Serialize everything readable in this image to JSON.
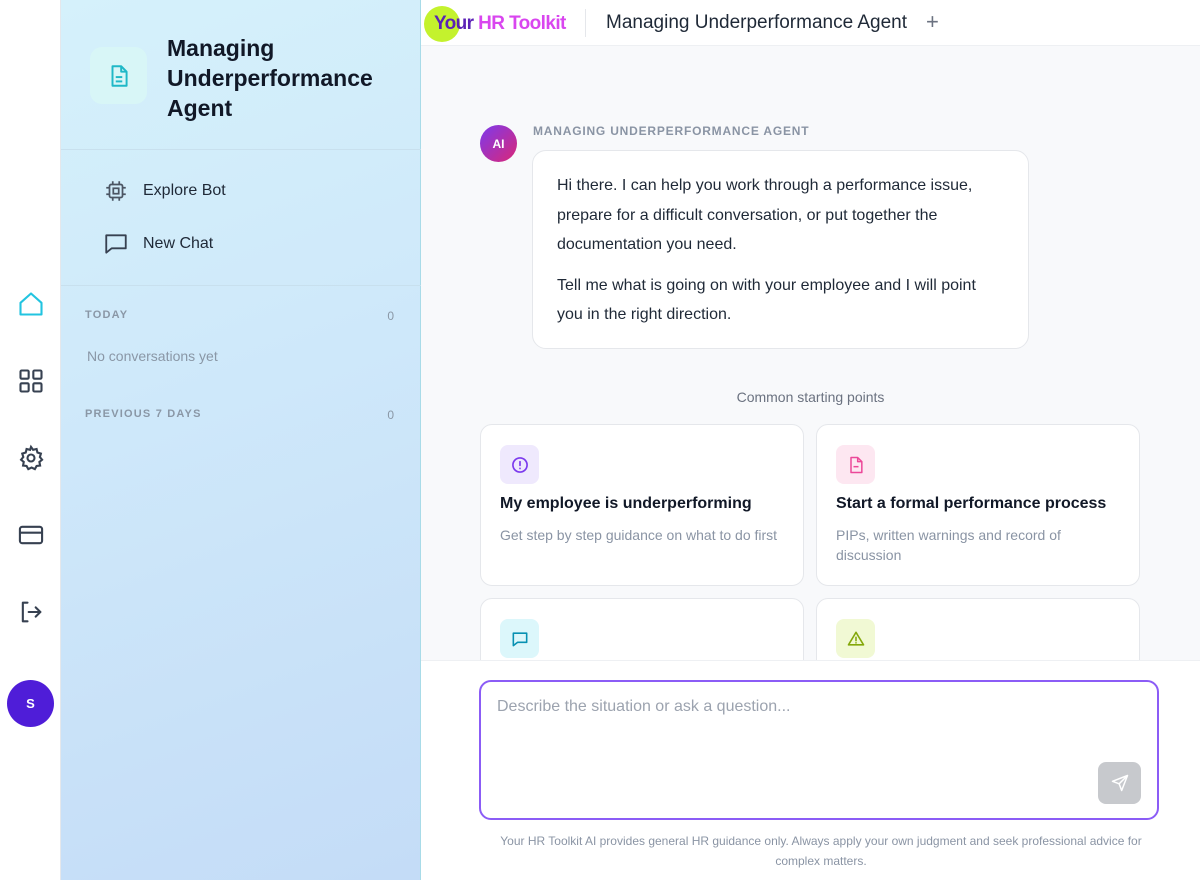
{
  "app": {
    "logo_part1": "Your",
    "logo_part2": "HR Toolkit",
    "tab_title": "Managing Underperformance Agent",
    "new_tab": "+"
  },
  "rail": {
    "items": [
      {
        "icon": "home-icon",
        "active": true
      },
      {
        "icon": "grid-icon"
      },
      {
        "icon": "gear-icon"
      },
      {
        "icon": "credit-card-icon"
      },
      {
        "icon": "logout-icon"
      }
    ],
    "avatar_initial": "S",
    "accent": "#22c4e0",
    "avatar_color": "#4f1dd8"
  },
  "sidebar": {
    "bot_title": "Managing Underperformance Agent",
    "explore_label": "Explore Bot",
    "new_chat_label": "New Chat",
    "today_label": "TODAY",
    "today_count": "0",
    "empty_text": "No conversations yet",
    "previous_label": "PREVIOUS 7 DAYS",
    "previous_count": "0"
  },
  "chat": {
    "avatar_label": "AI",
    "agent_label": "MANAGING UNDERPERFORMANCE AGENT",
    "message_p1": "Hi there. I can help you work through a performance issue, prepare for a difficult conversation, or put together the documentation you need.",
    "message_p2": "Tell me what is going on with your employee and I will point you in the right direction."
  },
  "starters": {
    "label": "Common starting points",
    "cards": [
      {
        "icon": "alert-circle-icon",
        "title": "My employee is underperforming",
        "desc": "Get step by step guidance on what to do first",
        "color": "#7c3aed",
        "bg": "#efe9fd"
      },
      {
        "icon": "document-icon",
        "title": "Start a formal performance process",
        "desc": "PIPs, written warnings and record of discussion",
        "color": "#ec4899",
        "bg": "#fde7f1"
      },
      {
        "icon": "message-icon",
        "title": "",
        "desc": "",
        "color": "#0891b2",
        "bg": "#dcf7fb"
      },
      {
        "icon": "warning-triangle-icon",
        "title": "",
        "desc": "",
        "color": "#84a80a",
        "bg": "#f1f9d4"
      }
    ]
  },
  "composer": {
    "placeholder": "Describe the situation or ask a question...",
    "disclaimer": "Your HR Toolkit AI provides general HR guidance only. Always apply your own judgment and seek professional advice for complex matters."
  }
}
